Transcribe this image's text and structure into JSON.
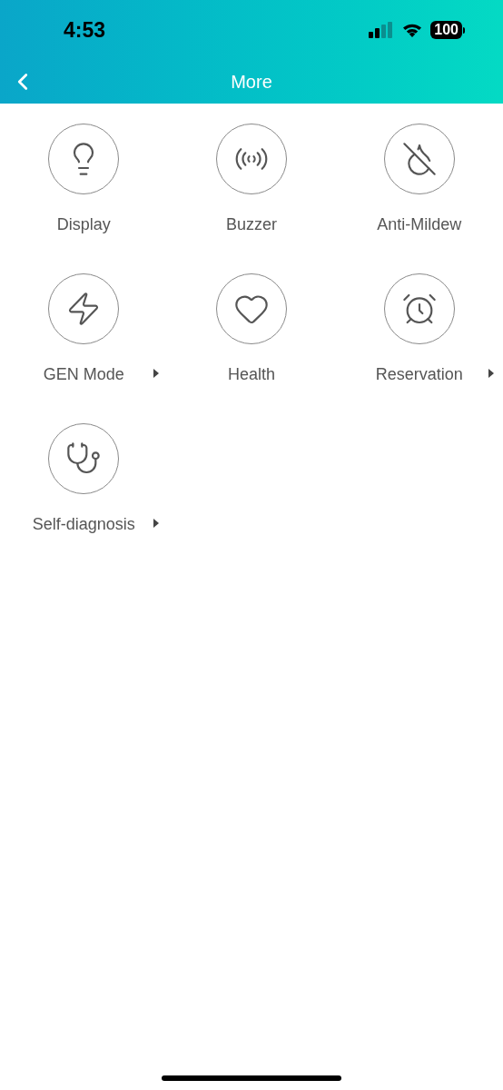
{
  "status_bar": {
    "time": "4:53",
    "battery": "100"
  },
  "nav": {
    "title": "More"
  },
  "items": [
    {
      "label": "Display",
      "kind": "bulb",
      "has_submenu": false
    },
    {
      "label": "Buzzer",
      "kind": "buzzer",
      "has_submenu": false
    },
    {
      "label": "Anti-Mildew",
      "kind": "drop-off",
      "has_submenu": false
    },
    {
      "label": "GEN Mode",
      "kind": "bolt",
      "has_submenu": true
    },
    {
      "label": "Health",
      "kind": "heart",
      "has_submenu": false
    },
    {
      "label": "Reservation",
      "kind": "alarm",
      "has_submenu": true
    },
    {
      "label": "Self-diagnosis",
      "kind": "stethoscope",
      "has_submenu": true
    }
  ]
}
